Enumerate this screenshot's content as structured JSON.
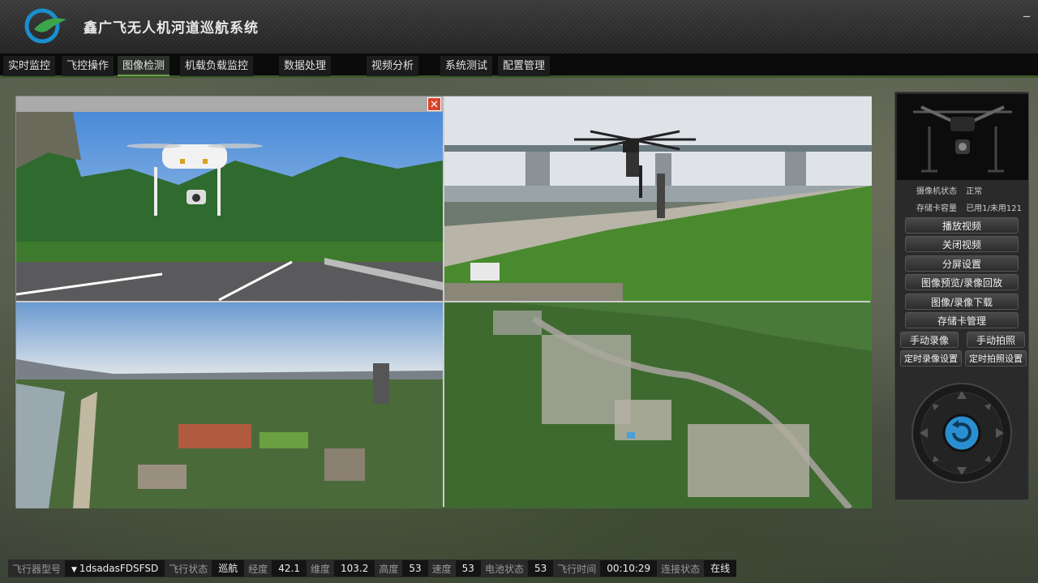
{
  "app": {
    "title": "鑫广飞无人机河道巡航系统",
    "minimize": "_"
  },
  "nav": {
    "tabs": [
      {
        "label": "实时监控"
      },
      {
        "label": "飞控操作"
      },
      {
        "label": "图像检测"
      },
      {
        "label": "机载负载监控"
      },
      {
        "label": "数据处理"
      },
      {
        "label": "视频分析"
      },
      {
        "label": "系统测试"
      },
      {
        "label": "配置管理"
      }
    ],
    "active": "图像检测"
  },
  "video": {
    "close": "✕"
  },
  "side": {
    "camera_status_label": "摄像机状态",
    "camera_status_value": "正常",
    "storage_label": "存储卡容量",
    "storage_value": "已用1/未用121",
    "buttons": {
      "play": "播放视频",
      "close": "关闭视频",
      "split": "分屏设置",
      "preview": "图像预览/录像回放",
      "download": "图像/录像下载",
      "card": "存储卡管理",
      "manual_record": "手动录像",
      "manual_photo": "手动拍照",
      "timed_record": "定时录像设置",
      "timed_photo": "定时拍照设置"
    },
    "ptz_icon": "refresh-icon"
  },
  "status": {
    "model_label": "飞行器型号",
    "model_value": "1dsadasFDSFSD",
    "state_label": "飞行状态",
    "state_value": "巡航",
    "lon_label": "经度",
    "lon_value": "42.1",
    "lat_label": "维度",
    "lat_value": "103.2",
    "alt_label": "高度",
    "alt_value": "53",
    "speed_label": "速度",
    "speed_value": "53",
    "battery_label": "电池状态",
    "battery_value": "53",
    "time_label": "飞行时间",
    "time_value": "00:10:29",
    "conn_label": "连接状态",
    "conn_value": "在线"
  },
  "colors": {
    "accent": "#6aa24a",
    "close": "#d9442c",
    "ptz": "#2a8fd0"
  }
}
